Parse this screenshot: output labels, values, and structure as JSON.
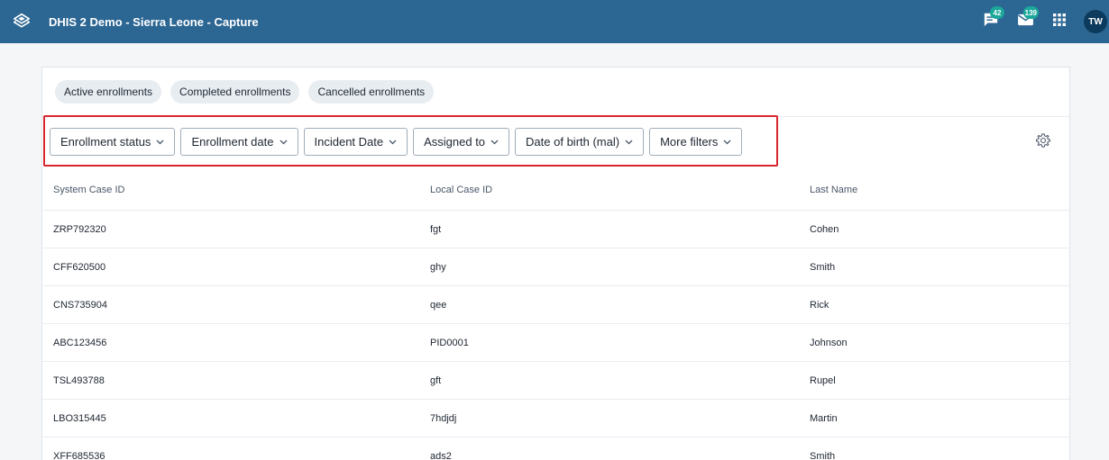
{
  "header": {
    "title": "DHIS 2 Demo - Sierra Leone - Capture",
    "logo_icon": "dhis2-logo-icon",
    "interpretations_badge": "42",
    "messages_badge": "139",
    "avatar_initials": "TW",
    "bg_color": "#2c6693"
  },
  "tabs": [
    {
      "label": "Active enrollments"
    },
    {
      "label": "Completed enrollments"
    },
    {
      "label": "Cancelled enrollments"
    }
  ],
  "filters": [
    {
      "label": "Enrollment status"
    },
    {
      "label": "Enrollment date"
    },
    {
      "label": "Incident Date"
    },
    {
      "label": "Assigned to"
    },
    {
      "label": "Date of birth (mal)"
    },
    {
      "label": "More filters"
    }
  ],
  "table": {
    "columns": [
      "System Case ID",
      "Local Case ID",
      "Last Name"
    ],
    "rows": [
      [
        "ZRP792320",
        "fgt",
        "Cohen"
      ],
      [
        "CFF620500",
        "ghy",
        "Smith"
      ],
      [
        "CNS735904",
        "qee",
        "Rick"
      ],
      [
        "ABC123456",
        "PID0001",
        "Johnson"
      ],
      [
        "TSL493788",
        "gft",
        "Rupel"
      ],
      [
        "LBO315445",
        "7hdjdj",
        "Martin"
      ],
      [
        "XFF685536",
        "ads2",
        "Smith"
      ]
    ]
  },
  "highlight_color": "#d8262d"
}
